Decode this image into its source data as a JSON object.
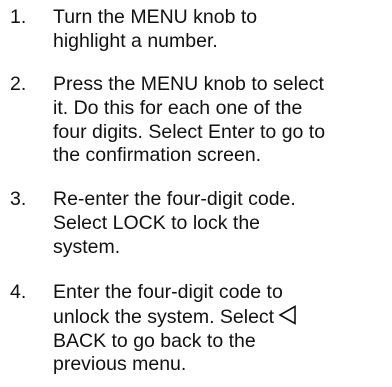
{
  "steps": [
    {
      "number": "1.",
      "lines": [
        "Turn the MENU knob to",
        "highlight a number."
      ]
    },
    {
      "number": "2.",
      "lines": [
        "Press the MENU knob to select",
        "it. Do this for each one of the",
        "four digits. Select Enter to go to",
        "the confirmation screen."
      ]
    },
    {
      "number": "3.",
      "lines": [
        "Re-enter the four-digit code.",
        "Select LOCK to lock the",
        "system."
      ]
    },
    {
      "number": "4.",
      "lines": [
        "Enter the four-digit code to",
        "unlock the system. Select",
        "BACK to go back to the",
        "previous menu."
      ],
      "icon": "back-triangle-icon"
    }
  ]
}
